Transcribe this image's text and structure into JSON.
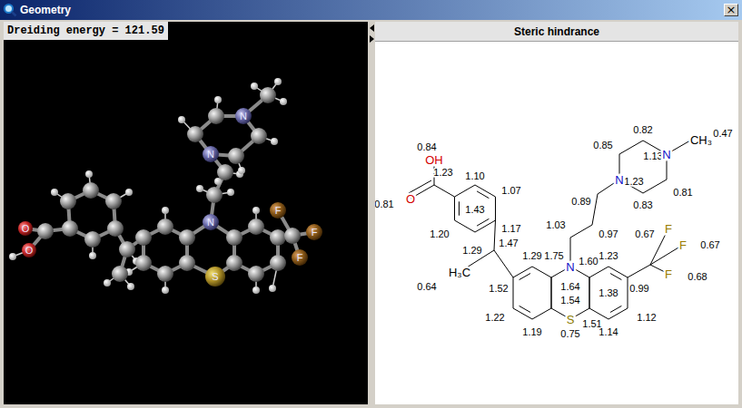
{
  "window": {
    "title": "Geometry",
    "close": "×"
  },
  "geometry_view": {
    "label": "Dreiding energy = 121.59",
    "atom_labels": [
      "N",
      "N",
      "N",
      "S",
      "F",
      "F",
      "F",
      "O",
      "O"
    ]
  },
  "steric_panel": {
    "title": "Steric hindrance",
    "atoms": [
      "OH",
      "O",
      "N",
      "N",
      "N",
      "S",
      "F",
      "F",
      "F",
      "CH₃",
      "H₃C"
    ],
    "values": [
      "0.84",
      "1.23",
      "1.10",
      "1.07",
      "0.81",
      "1.43",
      "1.20",
      "1.17",
      "1.47",
      "1.29",
      "1.52",
      "1.29",
      "0.64",
      "1.22",
      "1.19",
      "1.64",
      "1.54",
      "0.75",
      "1.75",
      "1.60",
      "1.23",
      "1.38",
      "1.51",
      "1.14",
      "1.12",
      "0.99",
      "0.67",
      "0.67",
      "0.68",
      "1.03",
      "0.97",
      "0.89",
      "1.23",
      "1.13",
      "0.85",
      "0.82",
      "0.81",
      "0.83",
      "0.47"
    ]
  }
}
